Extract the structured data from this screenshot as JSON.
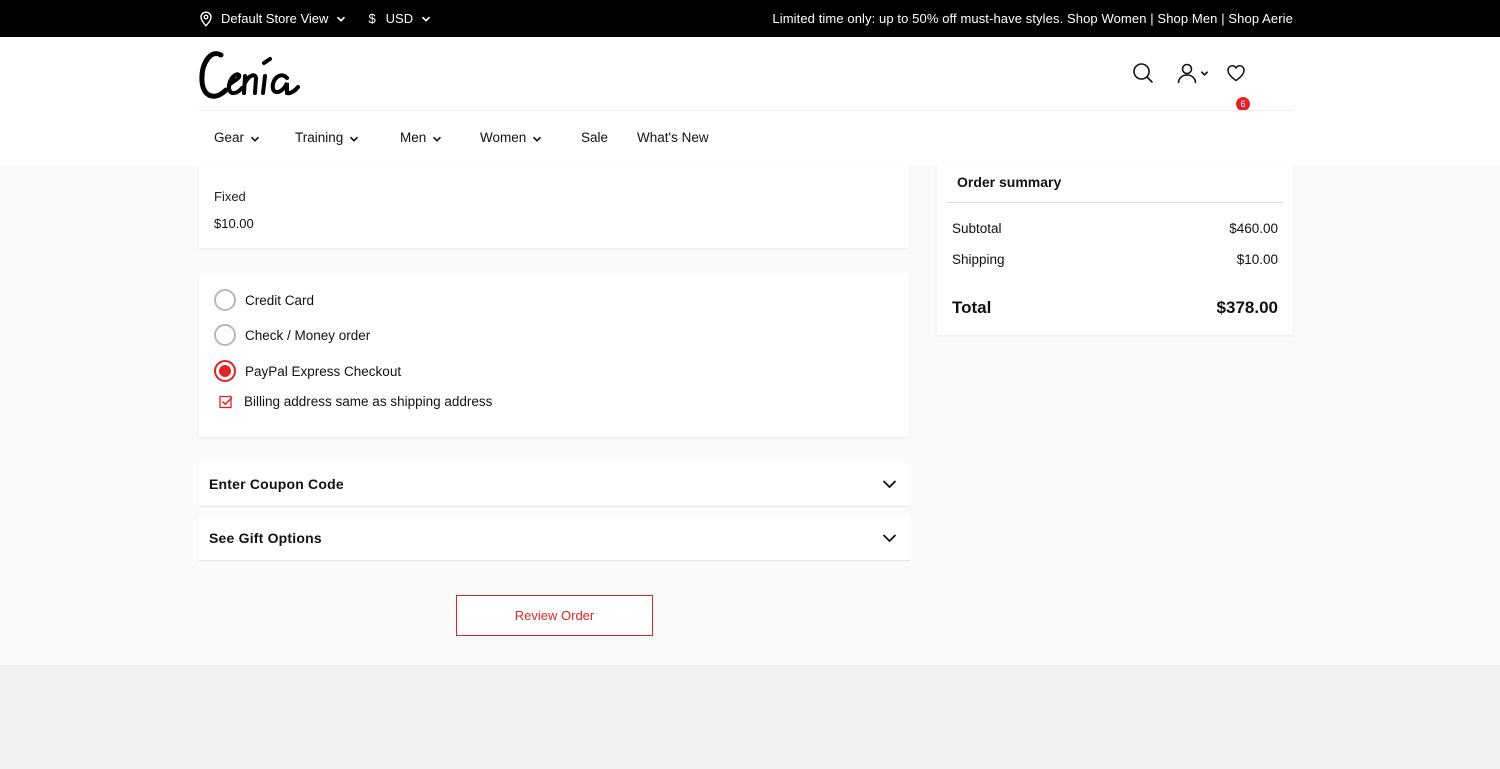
{
  "topbar": {
    "store_view": "Default Store View",
    "currency_symbol": "$",
    "currency": "USD",
    "promo": "Limited time only: up to 50% off must-have styles. Shop Women | Shop Men | Shop Aerie"
  },
  "header": {
    "logo_text": "Cenia",
    "wishlist_count": "6"
  },
  "nav": {
    "items": [
      {
        "label": "Gear",
        "dropdown": true
      },
      {
        "label": "Training",
        "dropdown": true
      },
      {
        "label": "Men",
        "dropdown": true
      },
      {
        "label": "Women",
        "dropdown": true
      },
      {
        "label": "Sale",
        "dropdown": false
      },
      {
        "label": "What's New",
        "dropdown": false
      }
    ]
  },
  "shipping_method": {
    "name": "Fixed",
    "price": "$10.00"
  },
  "payment": {
    "options": [
      {
        "label": "Credit Card",
        "selected": false
      },
      {
        "label": "Check / Money order",
        "selected": false
      },
      {
        "label": "PayPal Express Checkout",
        "selected": true
      }
    ],
    "billing_same_label": "Billing address same as shipping address",
    "billing_same_checked": true
  },
  "accordions": {
    "coupon": "Enter Coupon Code",
    "gift": "See Gift Options"
  },
  "review_button": "Review Order",
  "summary": {
    "title": "Order summary",
    "subtotal_label": "Subtotal",
    "subtotal_value": "$460.00",
    "shipping_label": "Shipping",
    "shipping_value": "$10.00",
    "total_label": "Total",
    "total_value": "$378.00"
  },
  "colors": {
    "accent": "#e02424",
    "topbar_bg": "#000000"
  }
}
